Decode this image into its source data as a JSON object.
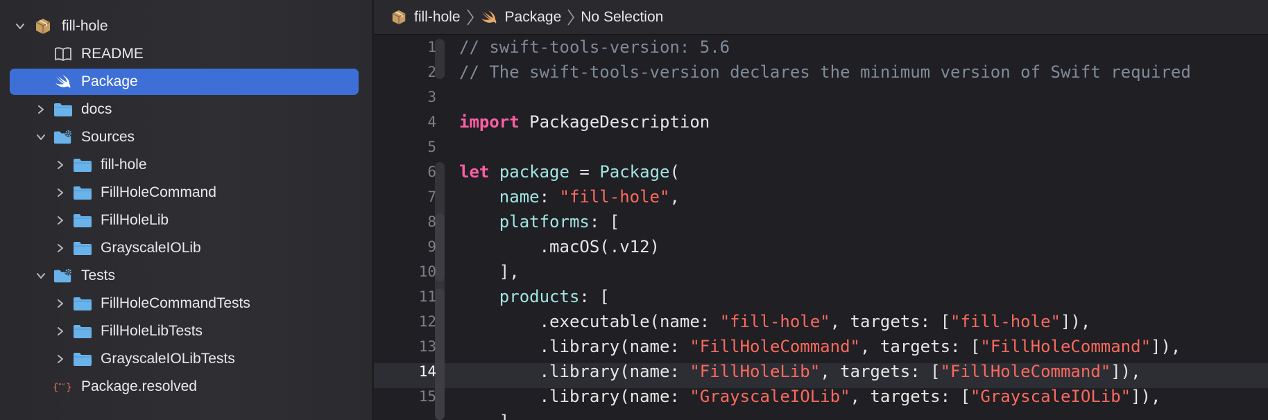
{
  "colors": {
    "selection": "#3d6fd6",
    "folder": "#69b2ea",
    "package_icon": "#d7b17a",
    "swift_icon": "#f0f0f0",
    "keyword": "#fc5fa3",
    "string": "#fc6a5d",
    "comment": "#7f8c98",
    "type_name": "#a1e5df"
  },
  "sidebar": {
    "items": [
      {
        "label": "fill-hole",
        "icon": "package-icon",
        "expanded": true
      },
      {
        "label": "README",
        "icon": "book-icon"
      },
      {
        "label": "Package",
        "icon": "swift-icon",
        "selected": true
      },
      {
        "label": "docs",
        "icon": "folder-icon",
        "expanded": false
      },
      {
        "label": "Sources",
        "icon": "folder-gear-icon",
        "expanded": true
      },
      {
        "label": "fill-hole",
        "icon": "folder-icon",
        "expanded": false
      },
      {
        "label": "FillHoleCommand",
        "icon": "folder-icon",
        "expanded": false
      },
      {
        "label": "FillHoleLib",
        "icon": "folder-icon",
        "expanded": false
      },
      {
        "label": "GrayscaleIOLib",
        "icon": "folder-icon",
        "expanded": false
      },
      {
        "label": "Tests",
        "icon": "folder-gear-icon",
        "expanded": true
      },
      {
        "label": "FillHoleCommandTests",
        "icon": "folder-icon",
        "expanded": false
      },
      {
        "label": "FillHoleLibTests",
        "icon": "folder-icon",
        "expanded": false
      },
      {
        "label": "GrayscaleIOLibTests",
        "icon": "folder-icon",
        "expanded": false
      },
      {
        "label": "Package.resolved",
        "icon": "json-icon"
      }
    ]
  },
  "jumpbar": {
    "project": "fill-hole",
    "file": "Package",
    "symbol": "No Selection"
  },
  "editor": {
    "current_line": 14,
    "lines": [
      {
        "n": "1",
        "tokens": [
          {
            "t": "// swift-tools-version: 5.6",
            "c": "cm"
          }
        ]
      },
      {
        "n": "2",
        "tokens": [
          {
            "t": "// The swift-tools-version declares the minimum version of Swift required",
            "c": "cm"
          }
        ]
      },
      {
        "n": "3",
        "tokens": []
      },
      {
        "n": "4",
        "tokens": [
          {
            "t": "import",
            "c": "kw"
          },
          {
            "t": " PackageDescription",
            "c": "pl"
          }
        ]
      },
      {
        "n": "5",
        "tokens": []
      },
      {
        "n": "6",
        "tokens": [
          {
            "t": "let",
            "c": "kw"
          },
          {
            "t": " ",
            "c": "pl"
          },
          {
            "t": "package",
            "c": "fn"
          },
          {
            "t": " = ",
            "c": "pl"
          },
          {
            "t": "Package",
            "c": "fn"
          },
          {
            "t": "(",
            "c": "pl"
          }
        ]
      },
      {
        "n": "7",
        "tokens": [
          {
            "t": "    ",
            "c": "pl"
          },
          {
            "t": "name",
            "c": "fn"
          },
          {
            "t": ": ",
            "c": "pl"
          },
          {
            "t": "\"fill-hole\"",
            "c": "st"
          },
          {
            "t": ",",
            "c": "pl"
          }
        ]
      },
      {
        "n": "8",
        "tokens": [
          {
            "t": "    ",
            "c": "pl"
          },
          {
            "t": "platforms",
            "c": "fn"
          },
          {
            "t": ": [",
            "c": "pl"
          }
        ]
      },
      {
        "n": "9",
        "tokens": [
          {
            "t": "        .macOS(.v12)",
            "c": "pl"
          }
        ]
      },
      {
        "n": "10",
        "tokens": [
          {
            "t": "    ],",
            "c": "pl"
          }
        ]
      },
      {
        "n": "11",
        "tokens": [
          {
            "t": "    ",
            "c": "pl"
          },
          {
            "t": "products",
            "c": "fn"
          },
          {
            "t": ": [",
            "c": "pl"
          }
        ]
      },
      {
        "n": "12",
        "tokens": [
          {
            "t": "        .executable(name: ",
            "c": "pl"
          },
          {
            "t": "\"fill-hole\"",
            "c": "st"
          },
          {
            "t": ", targets: [",
            "c": "pl"
          },
          {
            "t": "\"fill-hole\"",
            "c": "st"
          },
          {
            "t": "]),",
            "c": "pl"
          }
        ]
      },
      {
        "n": "13",
        "tokens": [
          {
            "t": "        .library(name: ",
            "c": "pl"
          },
          {
            "t": "\"FillHoleCommand\"",
            "c": "st"
          },
          {
            "t": ", targets: [",
            "c": "pl"
          },
          {
            "t": "\"FillHoleCommand\"",
            "c": "st"
          },
          {
            "t": "]),",
            "c": "pl"
          }
        ]
      },
      {
        "n": "14",
        "tokens": [
          {
            "t": "        .library(name: ",
            "c": "pl"
          },
          {
            "t": "\"FillHoleLib\"",
            "c": "st"
          },
          {
            "t": ", targets: [",
            "c": "pl"
          },
          {
            "t": "\"FillHoleCommand\"",
            "c": "st"
          },
          {
            "t": "]),",
            "c": "pl"
          }
        ]
      },
      {
        "n": "15",
        "tokens": [
          {
            "t": "        .library(name: ",
            "c": "pl"
          },
          {
            "t": "\"GrayscaleIOLib\"",
            "c": "st"
          },
          {
            "t": ", targets: [",
            "c": "pl"
          },
          {
            "t": "\"GrayscaleIOLib\"",
            "c": "st"
          },
          {
            "t": "]),",
            "c": "pl"
          }
        ]
      },
      {
        "n": "",
        "tokens": [
          {
            "t": "    ],",
            "c": "pl"
          }
        ]
      }
    ]
  }
}
